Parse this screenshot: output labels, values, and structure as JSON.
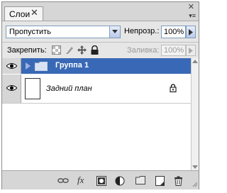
{
  "panel": {
    "tab_title": "Слои",
    "tab_close": "✕",
    "window_close": "✕",
    "menu_glyph": "▾≡"
  },
  "blend": {
    "mode": "Пропустить",
    "opacity_label": "Непрозр.:",
    "opacity_value": "100%"
  },
  "lock": {
    "label": "Закрепить:",
    "fill_label": "Заливка:",
    "fill_value": "100%"
  },
  "layers": [
    {
      "name": "Группа 1",
      "type": "group",
      "selected": true,
      "visible": true
    },
    {
      "name": "Задний план",
      "type": "background",
      "selected": false,
      "visible": true,
      "locked": true
    }
  ],
  "colors": {
    "selection": "#3969b6",
    "panel": "#d6d6d6"
  },
  "icons": {
    "bottom": [
      "link-layers-icon",
      "fx-icon",
      "mask-icon",
      "adjustment-icon",
      "new-group-icon",
      "new-layer-icon",
      "trash-icon"
    ],
    "fx_text": "fx"
  }
}
